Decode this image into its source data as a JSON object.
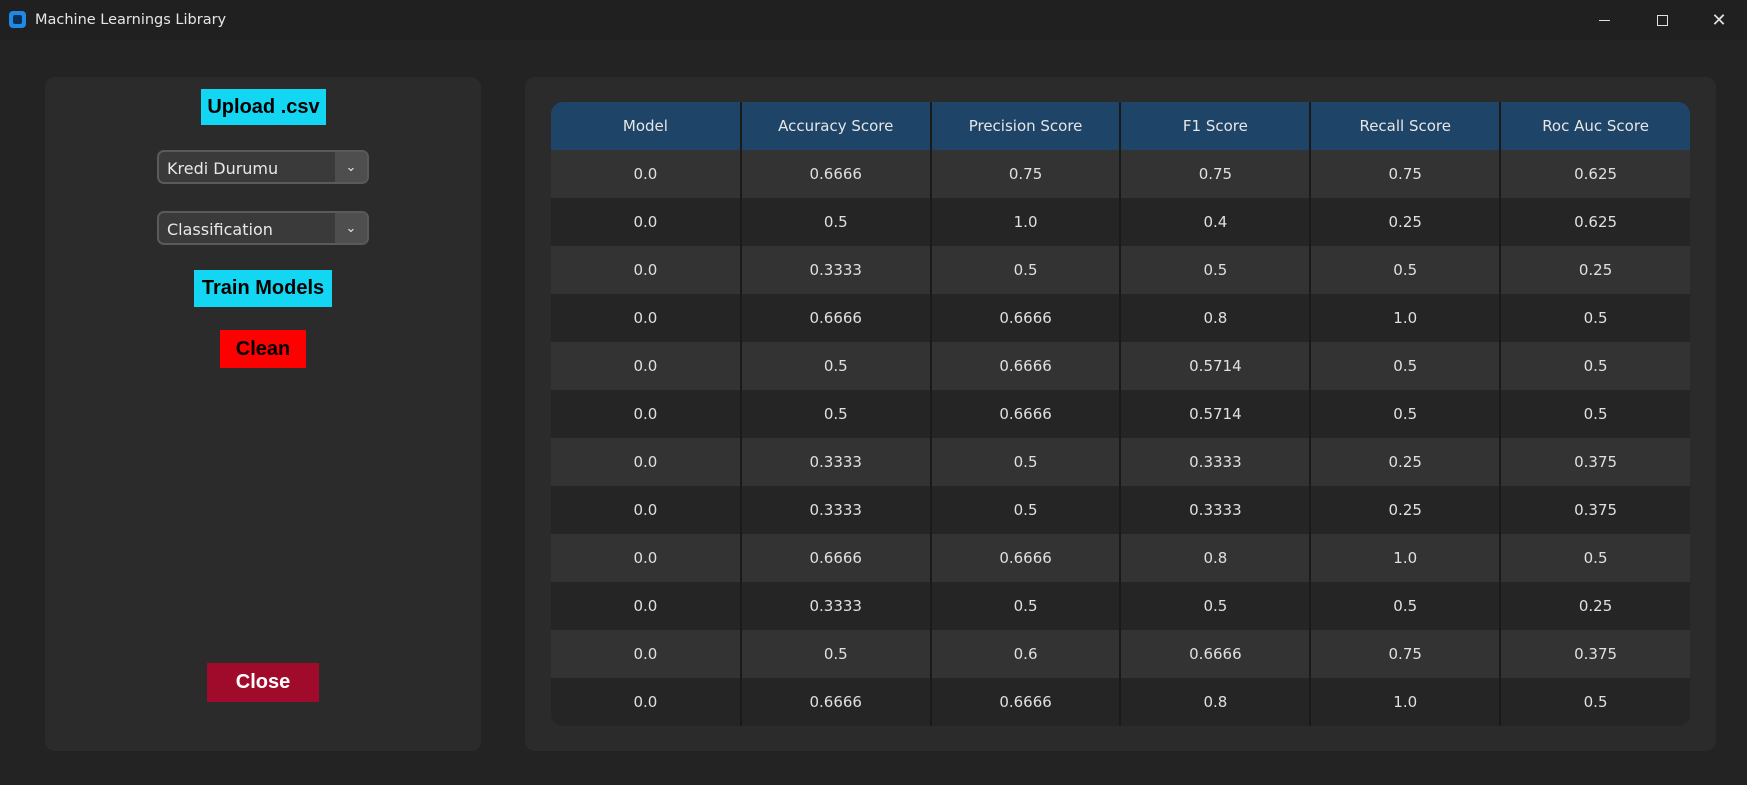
{
  "window": {
    "title": "Machine Learnings Library"
  },
  "controls": {
    "upload_label": "Upload .csv",
    "target_select": "Kredi Durumu",
    "task_select": "Classification",
    "train_label": "Train Models",
    "clean_label": "Clean",
    "close_label": "Close"
  },
  "table": {
    "headers": [
      "Model",
      "Accuracy Score",
      "Precision Score",
      "F1 Score",
      "Recall Score",
      "Roc Auc Score"
    ],
    "rows": [
      [
        "0.0",
        "0.6666",
        "0.75",
        "0.75",
        "0.75",
        "0.625"
      ],
      [
        "0.0",
        "0.5",
        "1.0",
        "0.4",
        "0.25",
        "0.625"
      ],
      [
        "0.0",
        "0.3333",
        "0.5",
        "0.5",
        "0.5",
        "0.25"
      ],
      [
        "0.0",
        "0.6666",
        "0.6666",
        "0.8",
        "1.0",
        "0.5"
      ],
      [
        "0.0",
        "0.5",
        "0.6666",
        "0.5714",
        "0.5",
        "0.5"
      ],
      [
        "0.0",
        "0.5",
        "0.6666",
        "0.5714",
        "0.5",
        "0.5"
      ],
      [
        "0.0",
        "0.3333",
        "0.5",
        "0.3333",
        "0.25",
        "0.375"
      ],
      [
        "0.0",
        "0.3333",
        "0.5",
        "0.3333",
        "0.25",
        "0.375"
      ],
      [
        "0.0",
        "0.6666",
        "0.6666",
        "0.8",
        "1.0",
        "0.5"
      ],
      [
        "0.0",
        "0.3333",
        "0.5",
        "0.5",
        "0.5",
        "0.25"
      ],
      [
        "0.0",
        "0.5",
        "0.6",
        "0.6666",
        "0.75",
        "0.375"
      ],
      [
        "0.0",
        "0.6666",
        "0.6666",
        "0.8",
        "1.0",
        "0.5"
      ]
    ]
  },
  "icons": {
    "app": "app-icon",
    "minimize": "minimize-icon",
    "maximize": "maximize-icon",
    "close": "close-icon",
    "dropdown": "chevron-down-icon"
  },
  "colors": {
    "accent_cyan": "#12d6f2",
    "clean_red": "#fe0000",
    "close_crimson": "#a10b2b",
    "header_blue": "#1e4468"
  }
}
